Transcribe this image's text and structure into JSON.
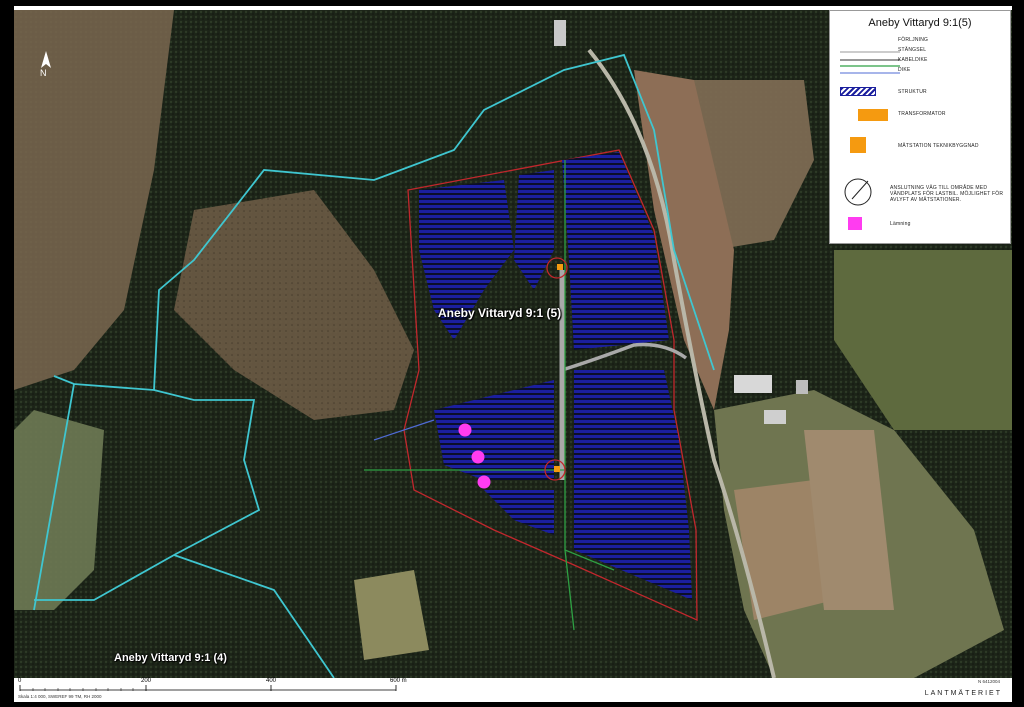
{
  "labels": {
    "parcel_main": "Aneby Vittaryd 9:1 (5)",
    "parcel_other": "Aneby Vittaryd 9:1 (4)",
    "north": "N"
  },
  "legend": {
    "title": "Aneby Vittaryd 9:1(5)",
    "items": [
      {
        "label": "FÖRLJNING",
        "symbol": "gray-line"
      },
      {
        "label": "STÄNGSEL",
        "symbol": "dark-line"
      },
      {
        "label": "KABELDIKE",
        "symbol": "green-line"
      },
      {
        "label": "DIKE",
        "symbol": "blue-line"
      },
      {
        "label": "STRUKTUR",
        "symbol": "blue-hatch-bar"
      },
      {
        "label": "TRANSFORMATOR",
        "symbol": "orange-rect"
      },
      {
        "label": "MÄTSTATION TEKNIKBYGGNAD",
        "symbol": "orange-square"
      },
      {
        "label": "ANSLUTNING VÄG TILL OMRÅDE MED VÄNDPLATS FÖR LASTBIL. MÖJLIGHET FÖR AVLYFT AV MÄTSTATIONER.",
        "symbol": "circle-turnaround"
      },
      {
        "label": "Lämning",
        "symbol": "magenta-square"
      }
    ]
  },
  "scale": {
    "ticks": [
      "0",
      "200",
      "400",
      "600 m"
    ],
    "scale_text": "Skala 1:4 000, SWEREF 99 TM, RH 2000",
    "corner_text": "N 6412004",
    "brand": "LANTMÄTERIET"
  },
  "colors": {
    "solar_panels": "#1b1f9e",
    "boundary_red": "#c2272d",
    "cadastral_cyan": "#3fc6d0",
    "cable_green": "#2ea043",
    "lamning_magenta": "#ff3cf0",
    "transformer_orange": "#f59a10"
  }
}
